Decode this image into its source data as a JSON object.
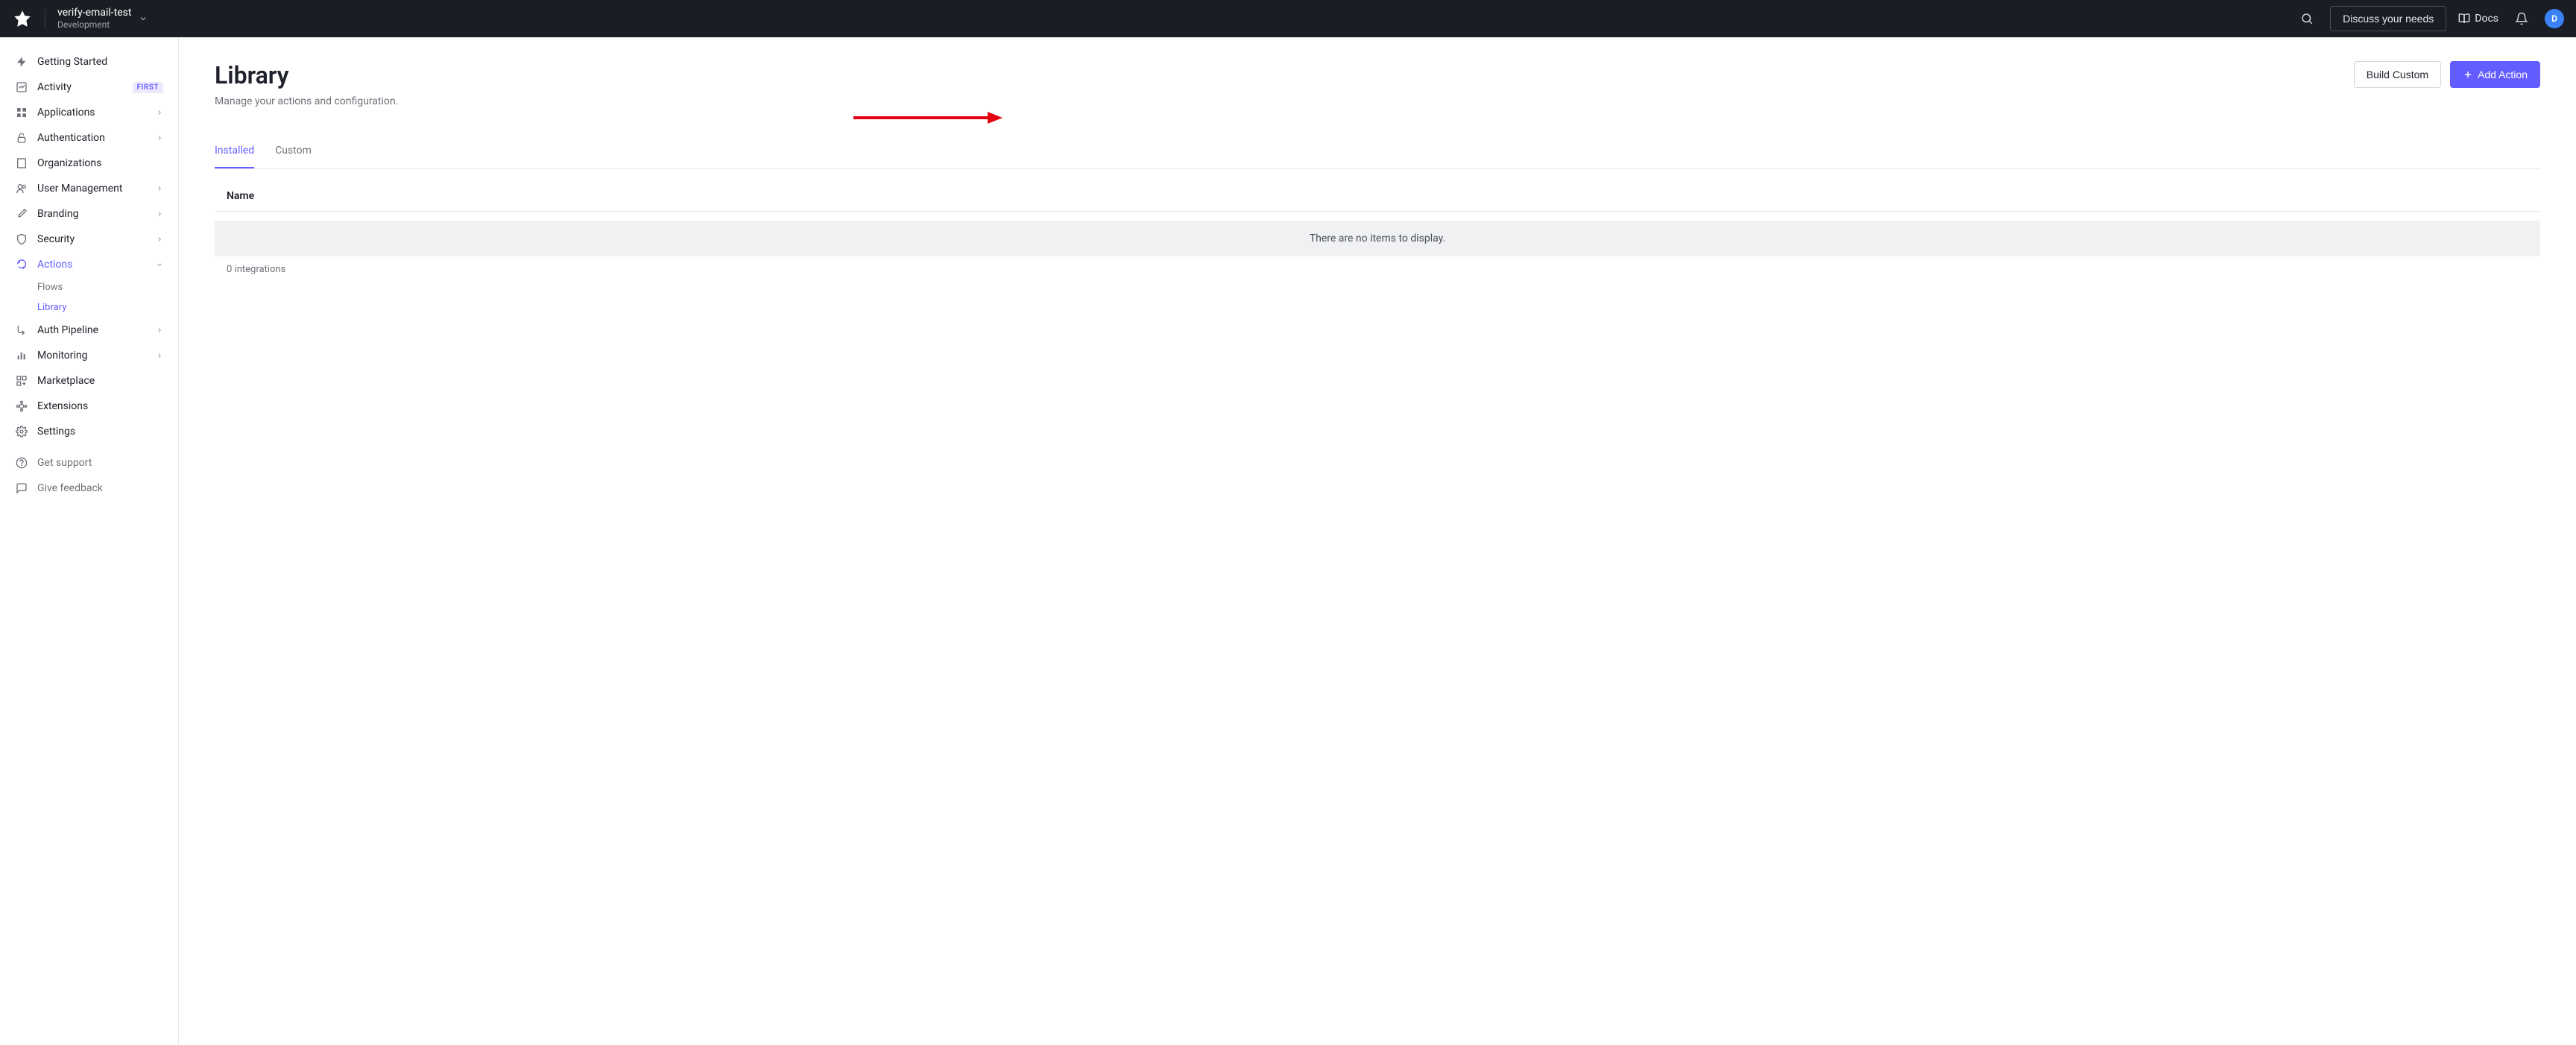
{
  "header": {
    "tenant_name": "verify-email-test",
    "tenant_env": "Development",
    "discuss_label": "Discuss your needs",
    "docs_label": "Docs",
    "avatar_initial": "D"
  },
  "sidebar": {
    "items": [
      {
        "label": "Getting Started",
        "icon": "bolt",
        "expandable": false
      },
      {
        "label": "Activity",
        "icon": "chart",
        "badge": "FIRST",
        "expandable": false
      },
      {
        "label": "Applications",
        "icon": "apps",
        "expandable": true
      },
      {
        "label": "Authentication",
        "icon": "lock",
        "expandable": true
      },
      {
        "label": "Organizations",
        "icon": "org",
        "expandable": false
      },
      {
        "label": "User Management",
        "icon": "users",
        "expandable": true
      },
      {
        "label": "Branding",
        "icon": "brush",
        "expandable": true
      },
      {
        "label": "Security",
        "icon": "shield",
        "expandable": true
      },
      {
        "label": "Actions",
        "icon": "actions",
        "expandable": true,
        "active": true,
        "expanded": true,
        "subitems": [
          {
            "label": "Flows",
            "active": false
          },
          {
            "label": "Library",
            "active": true
          }
        ]
      },
      {
        "label": "Auth Pipeline",
        "icon": "pipeline",
        "expandable": true
      },
      {
        "label": "Monitoring",
        "icon": "bars",
        "expandable": true
      },
      {
        "label": "Marketplace",
        "icon": "market",
        "expandable": false
      },
      {
        "label": "Extensions",
        "icon": "puzzle",
        "expandable": false
      },
      {
        "label": "Settings",
        "icon": "gear",
        "expandable": false
      }
    ],
    "footer": [
      {
        "label": "Get support",
        "icon": "help"
      },
      {
        "label": "Give feedback",
        "icon": "feedback"
      }
    ]
  },
  "page": {
    "title": "Library",
    "subtitle": "Manage your actions and configuration.",
    "build_custom_label": "Build Custom",
    "add_action_label": "Add Action"
  },
  "tabs": {
    "installed": "Installed",
    "custom": "Custom"
  },
  "table": {
    "header_name": "Name",
    "empty_message": "There are no items to display.",
    "footer": "0 integrations"
  },
  "annotation": {
    "arrow_color": "#e3000f"
  }
}
